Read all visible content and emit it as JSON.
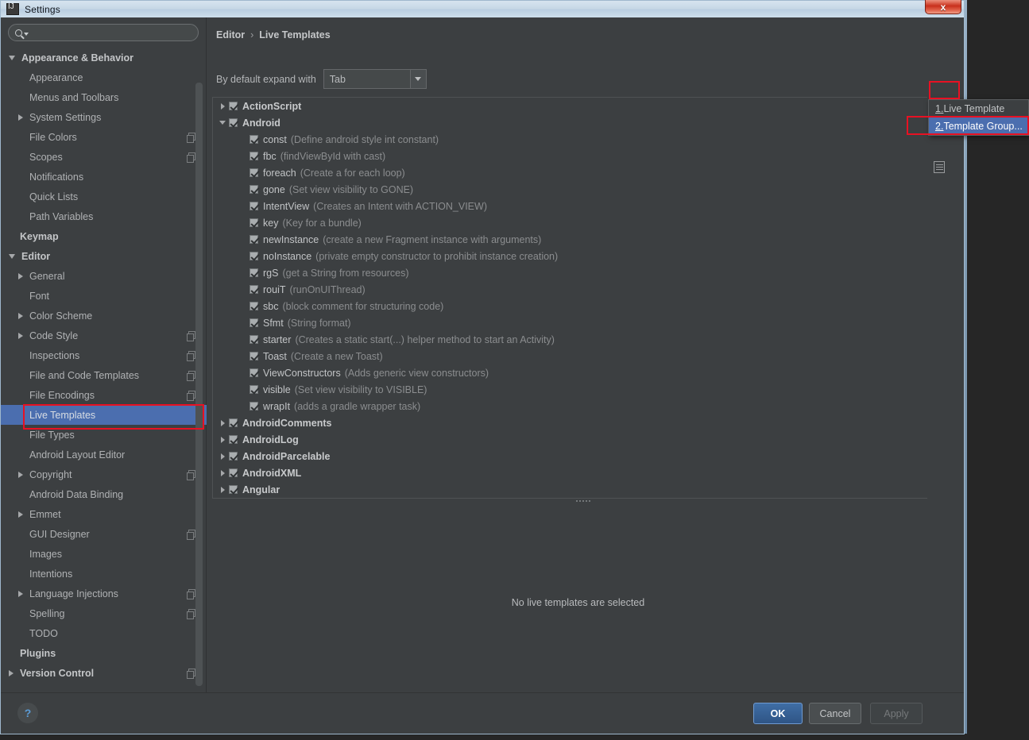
{
  "window": {
    "title": "Settings",
    "app_icon": "intellij-idea-icon",
    "close_label": "x"
  },
  "sidebar": {
    "search": {
      "value": "",
      "placeholder": ""
    },
    "items": [
      {
        "label": "Appearance & Behavior",
        "level": 0,
        "arrow": "down",
        "bold": true,
        "copy": false,
        "selected": false
      },
      {
        "label": "Appearance",
        "level": 1,
        "arrow": "none",
        "bold": false,
        "copy": false,
        "selected": false
      },
      {
        "label": "Menus and Toolbars",
        "level": 1,
        "arrow": "none",
        "bold": false,
        "copy": false,
        "selected": false
      },
      {
        "label": "System Settings",
        "level": 1,
        "arrow": "right",
        "bold": false,
        "copy": false,
        "selected": false
      },
      {
        "label": "File Colors",
        "level": 1,
        "arrow": "none",
        "bold": false,
        "copy": true,
        "selected": false
      },
      {
        "label": "Scopes",
        "level": 1,
        "arrow": "none",
        "bold": false,
        "copy": true,
        "selected": false
      },
      {
        "label": "Notifications",
        "level": 1,
        "arrow": "none",
        "bold": false,
        "copy": false,
        "selected": false
      },
      {
        "label": "Quick Lists",
        "level": 1,
        "arrow": "none",
        "bold": false,
        "copy": false,
        "selected": false
      },
      {
        "label": "Path Variables",
        "level": 1,
        "arrow": "none",
        "bold": false,
        "copy": false,
        "selected": false
      },
      {
        "label": "Keymap",
        "level": 0,
        "arrow": "none",
        "bold": true,
        "copy": false,
        "selected": false
      },
      {
        "label": "Editor",
        "level": 0,
        "arrow": "down",
        "bold": true,
        "copy": false,
        "selected": false
      },
      {
        "label": "General",
        "level": 1,
        "arrow": "right",
        "bold": false,
        "copy": false,
        "selected": false
      },
      {
        "label": "Font",
        "level": 1,
        "arrow": "none",
        "bold": false,
        "copy": false,
        "selected": false
      },
      {
        "label": "Color Scheme",
        "level": 1,
        "arrow": "right",
        "bold": false,
        "copy": false,
        "selected": false
      },
      {
        "label": "Code Style",
        "level": 1,
        "arrow": "right",
        "bold": false,
        "copy": true,
        "selected": false
      },
      {
        "label": "Inspections",
        "level": 1,
        "arrow": "none",
        "bold": false,
        "copy": true,
        "selected": false
      },
      {
        "label": "File and Code Templates",
        "level": 1,
        "arrow": "none",
        "bold": false,
        "copy": true,
        "selected": false
      },
      {
        "label": "File Encodings",
        "level": 1,
        "arrow": "none",
        "bold": false,
        "copy": true,
        "selected": false
      },
      {
        "label": "Live Templates",
        "level": 1,
        "arrow": "none",
        "bold": false,
        "copy": false,
        "selected": true
      },
      {
        "label": "File Types",
        "level": 1,
        "arrow": "none",
        "bold": false,
        "copy": false,
        "selected": false
      },
      {
        "label": "Android Layout Editor",
        "level": 1,
        "arrow": "none",
        "bold": false,
        "copy": false,
        "selected": false
      },
      {
        "label": "Copyright",
        "level": 1,
        "arrow": "right",
        "bold": false,
        "copy": true,
        "selected": false
      },
      {
        "label": "Android Data Binding",
        "level": 1,
        "arrow": "none",
        "bold": false,
        "copy": false,
        "selected": false
      },
      {
        "label": "Emmet",
        "level": 1,
        "arrow": "right",
        "bold": false,
        "copy": false,
        "selected": false
      },
      {
        "label": "GUI Designer",
        "level": 1,
        "arrow": "none",
        "bold": false,
        "copy": true,
        "selected": false
      },
      {
        "label": "Images",
        "level": 1,
        "arrow": "none",
        "bold": false,
        "copy": false,
        "selected": false
      },
      {
        "label": "Intentions",
        "level": 1,
        "arrow": "none",
        "bold": false,
        "copy": false,
        "selected": false
      },
      {
        "label": "Language Injections",
        "level": 1,
        "arrow": "right",
        "bold": false,
        "copy": true,
        "selected": false
      },
      {
        "label": "Spelling",
        "level": 1,
        "arrow": "none",
        "bold": false,
        "copy": true,
        "selected": false
      },
      {
        "label": "TODO",
        "level": 1,
        "arrow": "none",
        "bold": false,
        "copy": false,
        "selected": false
      },
      {
        "label": "Plugins",
        "level": 0,
        "arrow": "none",
        "bold": true,
        "copy": false,
        "selected": false
      },
      {
        "label": "Version Control",
        "level": 0,
        "arrow": "right",
        "bold": true,
        "copy": true,
        "selected": false
      }
    ]
  },
  "main": {
    "breadcrumb": {
      "parent": "Editor",
      "separator": "›",
      "current": "Live Templates"
    },
    "expand": {
      "label": "By default expand with",
      "value": "Tab"
    },
    "empty_message": "No live templates are selected",
    "templates": [
      {
        "name": "ActionScript",
        "desc": "",
        "type": "group",
        "arrow": "right",
        "checked": true
      },
      {
        "name": "Android",
        "desc": "",
        "type": "group",
        "arrow": "down",
        "checked": true
      },
      {
        "name": "const",
        "desc": "(Define android style int constant)",
        "type": "leaf",
        "arrow": "none",
        "checked": true
      },
      {
        "name": "fbc",
        "desc": "(findViewById with cast)",
        "type": "leaf",
        "arrow": "none",
        "checked": true
      },
      {
        "name": "foreach",
        "desc": "(Create a for each loop)",
        "type": "leaf",
        "arrow": "none",
        "checked": true
      },
      {
        "name": "gone",
        "desc": "(Set view visibility to GONE)",
        "type": "leaf",
        "arrow": "none",
        "checked": true
      },
      {
        "name": "IntentView",
        "desc": "(Creates an Intent with ACTION_VIEW)",
        "type": "leaf",
        "arrow": "none",
        "checked": true
      },
      {
        "name": "key",
        "desc": "(Key for a bundle)",
        "type": "leaf",
        "arrow": "none",
        "checked": true
      },
      {
        "name": "newInstance",
        "desc": "(create a new Fragment instance with arguments)",
        "type": "leaf",
        "arrow": "none",
        "checked": true
      },
      {
        "name": "noInstance",
        "desc": "(private empty constructor to prohibit instance creation)",
        "type": "leaf",
        "arrow": "none",
        "checked": true
      },
      {
        "name": "rgS",
        "desc": "(get a String from resources)",
        "type": "leaf",
        "arrow": "none",
        "checked": true
      },
      {
        "name": "rouiT",
        "desc": "(runOnUIThread)",
        "type": "leaf",
        "arrow": "none",
        "checked": true
      },
      {
        "name": "sbc",
        "desc": "(block comment for structuring code)",
        "type": "leaf",
        "arrow": "none",
        "checked": true
      },
      {
        "name": "Sfmt",
        "desc": "(String format)",
        "type": "leaf",
        "arrow": "none",
        "checked": true
      },
      {
        "name": "starter",
        "desc": "(Creates a static start(...) helper method to start an Activity)",
        "type": "leaf",
        "arrow": "none",
        "checked": true
      },
      {
        "name": "Toast",
        "desc": "(Create a new Toast)",
        "type": "leaf",
        "arrow": "none",
        "checked": true
      },
      {
        "name": "ViewConstructors",
        "desc": "(Adds generic view constructors)",
        "type": "leaf",
        "arrow": "none",
        "checked": true
      },
      {
        "name": "visible",
        "desc": "(Set view visibility to VISIBLE)",
        "type": "leaf",
        "arrow": "none",
        "checked": true
      },
      {
        "name": "wrapIt",
        "desc": "(adds a gradle wrapper task)",
        "type": "leaf",
        "arrow": "none",
        "checked": true
      },
      {
        "name": "AndroidComments",
        "desc": "",
        "type": "group",
        "arrow": "right",
        "checked": true
      },
      {
        "name": "AndroidLog",
        "desc": "",
        "type": "group",
        "arrow": "right",
        "checked": true
      },
      {
        "name": "AndroidParcelable",
        "desc": "",
        "type": "group",
        "arrow": "right",
        "checked": true
      },
      {
        "name": "AndroidXML",
        "desc": "",
        "type": "group",
        "arrow": "right",
        "checked": true
      },
      {
        "name": "Angular",
        "desc": "",
        "type": "group",
        "arrow": "right",
        "checked": true
      }
    ],
    "toolbar": {
      "add_icon": "plus-icon",
      "copy_icon": "copy-template-icon"
    },
    "popup": {
      "items": [
        {
          "mnemonic": "1.",
          "label": " Live Template",
          "selected": false
        },
        {
          "mnemonic": "2.",
          "label": " Template Group...",
          "selected": true
        }
      ]
    }
  },
  "footer": {
    "help_label": "?",
    "ok_label": "OK",
    "cancel_label": "Cancel",
    "apply_label": "Apply"
  },
  "colors": {
    "accent_selection": "#4b6eaf",
    "annotation_red": "#e81123",
    "plus_green": "#2fc14a",
    "panel_bg": "#3c3f41",
    "help_blue": "#5b9bd5"
  }
}
